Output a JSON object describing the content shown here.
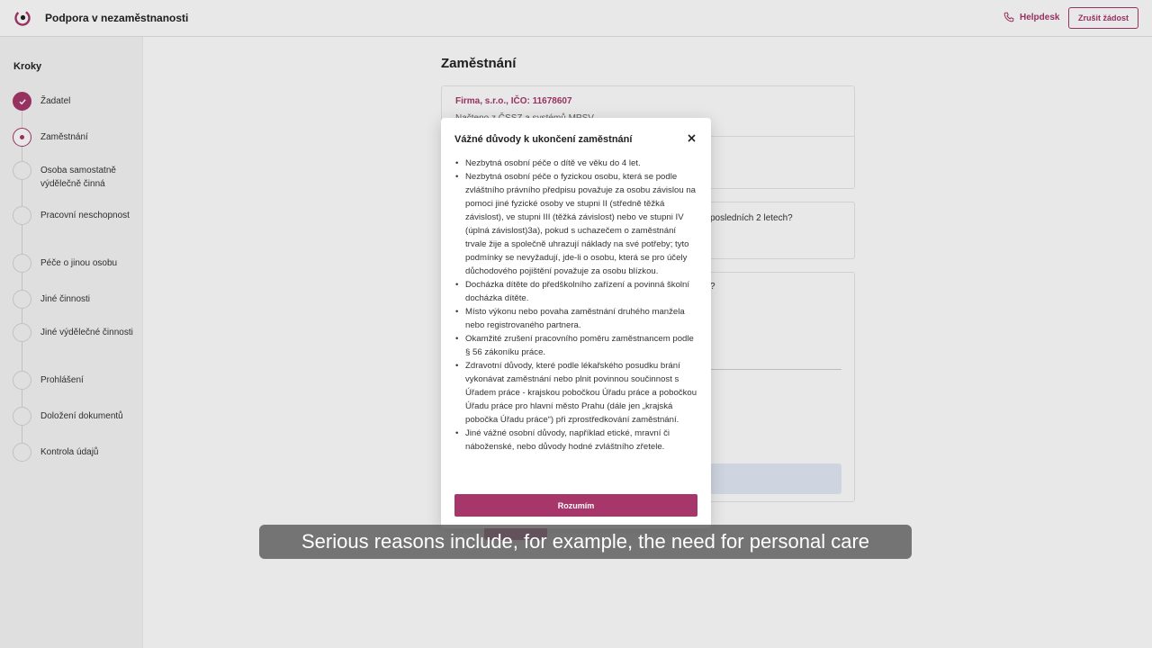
{
  "header": {
    "app_title": "Podpora v nezaměstnanosti",
    "helpdesk_label": "Helpdesk",
    "cancel_label": "Zrušit žádost"
  },
  "sidebar": {
    "title": "Kroky",
    "steps": [
      {
        "label": "Žadatel",
        "status": "done"
      },
      {
        "label": "Zaměstnání",
        "status": "active"
      },
      {
        "label": "Osoba samostatně výdělečně činná",
        "status": "pending"
      },
      {
        "label": "Pracovní neschopnost",
        "status": "pending"
      },
      {
        "label": "Péče o jinou osobu",
        "status": "pending"
      },
      {
        "label": "Jiné činnosti",
        "status": "pending"
      },
      {
        "label": "Jiné výdělečné činnosti",
        "status": "pending"
      },
      {
        "label": "Prohlášení",
        "status": "pending"
      },
      {
        "label": "Doložení dokumentů",
        "status": "pending"
      },
      {
        "label": "Kontrola údajů",
        "status": "pending"
      }
    ]
  },
  "main": {
    "title": "Zaměstnání",
    "company": "Firma, s.r.o., IČO: 11678607",
    "company_sub": "Načteno z ČSSZ a systémů MPSV",
    "question_partial_1": "posledních 2 letech?",
    "question_partial_2": "?"
  },
  "modal": {
    "title": "Vážné důvody k ukončení zaměstnání",
    "reasons": [
      "Nezbytná osobní péče o dítě ve věku do 4 let.",
      "Nezbytná osobní péče o fyzickou osobu, která se podle zvláštního právního předpisu považuje za osobu závislou na pomoci jiné fyzické osoby ve stupni II (středně těžká závislost), ve stupni III (těžká závislost) nebo ve stupni IV (úplná závislost)3a), pokud s uchazečem o zaměstnání trvale žije a společně uhrazují náklady na své potřeby; tyto podmínky se nevyžadují, jde-li o osobu, která se pro účely důchodového pojištění považuje za osobu blízkou.",
      "Docházka dítěte do předškolního zařízení a povinná školní docházka dítěte.",
      "Místo výkonu nebo povaha zaměstnání druhého manžela nebo registrovaného partnera.",
      "Okamžité zrušení pracovního poměru zaměstnancem podle § 56 zákoníku práce.",
      "Zdravotní důvody, které podle lékařského posudku brání vykonávat zaměstnání nebo plnit povinnou součinnost s Úřadem práce - krajskou pobočkou Úřadu práce a pobočkou Úřadu práce pro hlavní město Prahu (dále jen „krajská pobočka Úřadu práce“) při zprostředkování zaměstnání.",
      "Jiné vážné osobní důvody, například etické, mravní či náboženské, nebo důvody hodné zvláštního zřetele."
    ],
    "confirm_label": "Rozumím"
  },
  "caption": "Serious reasons include, for example, the need for personal care",
  "colors": {
    "accent": "#a7376a",
    "sidebar_bg": "#f6f6f6"
  }
}
